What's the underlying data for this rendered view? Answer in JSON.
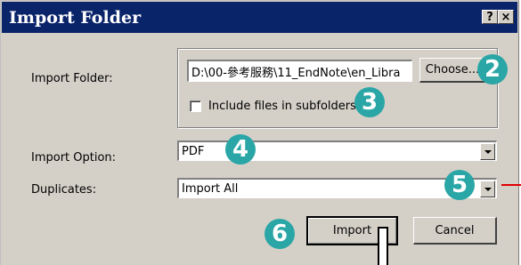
{
  "window": {
    "title": "Import Folder",
    "help_btn": "?",
    "close_btn": "×"
  },
  "import_folder": {
    "label": "Import Folder:",
    "path_value": "D:\\00-參考服務\\11_EndNote\\en_Libra",
    "choose_label": "Choose...",
    "include_subfolders_label": "Include files in subfolders",
    "include_subfolders_checked": false
  },
  "import_option": {
    "label": "Import Option:",
    "value": "PDF"
  },
  "duplicates": {
    "label": "Duplicates:",
    "value": "Import All"
  },
  "buttons": {
    "import_label": "Import",
    "cancel_label": "Cancel"
  },
  "annotations": {
    "step2": "2",
    "step3": "3",
    "step4": "4",
    "step5": "5",
    "step6": "6",
    "color": "#2aa6a6",
    "arrow_color": "#e00000"
  }
}
